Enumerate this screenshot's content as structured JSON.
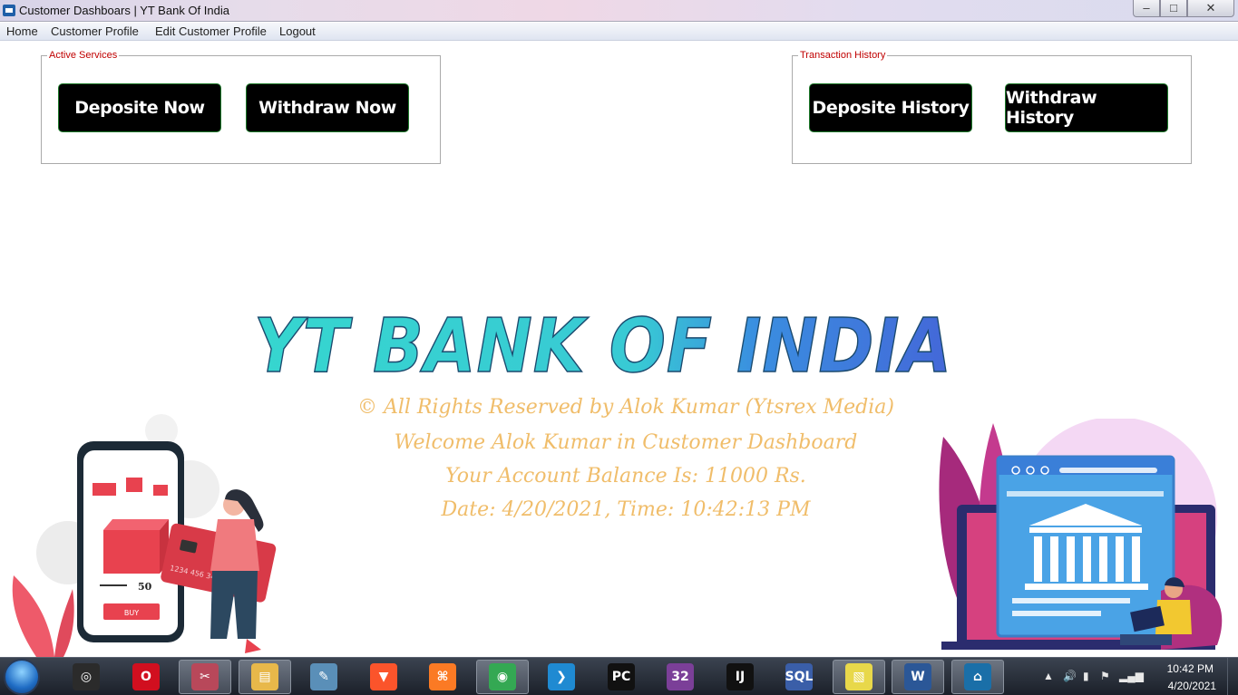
{
  "window": {
    "title": "Customer Dashboars | YT Bank Of India",
    "minimize_glyph": "–",
    "maximize_glyph": "□",
    "close_glyph": "✕"
  },
  "menu": {
    "home": "Home",
    "customer_profile": "Customer Profile",
    "edit_customer_profile": "Edit Customer Profile",
    "logout": "Logout"
  },
  "active_services": {
    "legend": "Active Services",
    "deposite_now": "Deposite Now",
    "withdraw_now": "Withdraw Now"
  },
  "transaction_history": {
    "legend": "Transaction History",
    "deposite_history": "Deposite History",
    "withdraw_history": "Withdraw History"
  },
  "dashboard": {
    "logo_text": "YT BANK OF INDIA",
    "copyright": "© All Rights Reserved by Alok Kumar (Ytsrex Media)",
    "welcome": "Welcome Alok Kumar in Customer Dashboard",
    "balance": "Your Account Balance Is: 11000 Rs.",
    "datetime": "Date: 4/20/2021, Time: 10:42:13 PM"
  },
  "illustration_left": {
    "price": "50",
    "buy": "BUY",
    "card_number": "1234 456 3417 789 163"
  },
  "taskbar": {
    "apps": [
      {
        "name": "obs-icon",
        "glyph": "◎",
        "color": "#2b2b2b"
      },
      {
        "name": "opera-icon",
        "glyph": "O",
        "color": "#d10f1f"
      },
      {
        "name": "snipping-tool-icon",
        "glyph": "✂",
        "color": "#b8485a"
      },
      {
        "name": "file-explorer-icon",
        "glyph": "▤",
        "color": "#e8b84a"
      },
      {
        "name": "notepad-icon",
        "glyph": "✎",
        "color": "#5a8fb8"
      },
      {
        "name": "brave-icon",
        "glyph": "▼",
        "color": "#fb542b"
      },
      {
        "name": "xampp-icon",
        "glyph": "⌘",
        "color": "#fb7a24"
      },
      {
        "name": "chrome-icon",
        "glyph": "◉",
        "color": "#34a853"
      },
      {
        "name": "vscode-icon",
        "glyph": "❯",
        "color": "#1f8ad2"
      },
      {
        "name": "pycharm-icon",
        "glyph": "PC",
        "color": "#111111"
      },
      {
        "name": "winrar-icon",
        "glyph": "32",
        "color": "#7b3f98"
      },
      {
        "name": "intellij-icon",
        "glyph": "IJ",
        "color": "#111111"
      },
      {
        "name": "sql-shell-icon",
        "glyph": "SQL",
        "color": "#3a5ea8"
      },
      {
        "name": "sticky-notes-icon",
        "glyph": "▧",
        "color": "#e8d84a"
      },
      {
        "name": "word-icon",
        "glyph": "W",
        "color": "#2b5797"
      },
      {
        "name": "bank-app-icon",
        "glyph": "⌂",
        "color": "#1a6fa8"
      }
    ],
    "clock_time": "10:42 PM",
    "clock_date": "4/20/2021"
  }
}
